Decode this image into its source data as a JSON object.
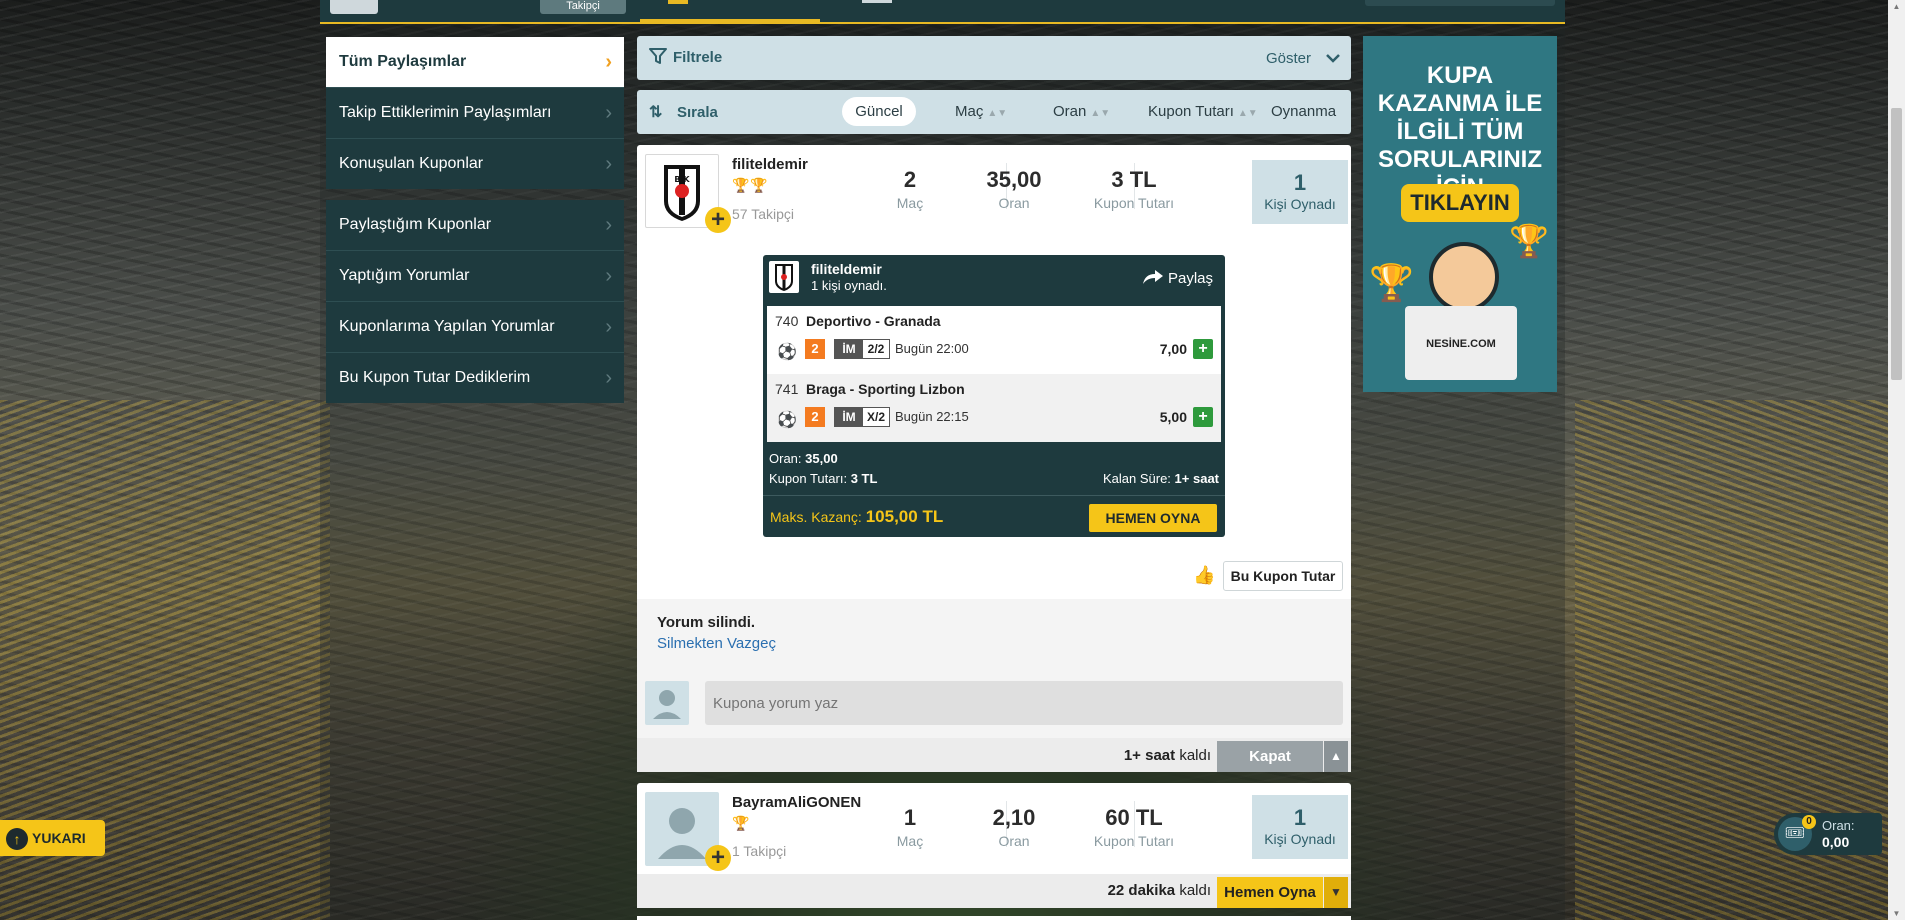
{
  "topbar": {
    "takipci_label": "Takipçi"
  },
  "left_menu": {
    "group1": [
      {
        "label": "Tüm Paylaşımlar",
        "active": true
      },
      {
        "label": "Takip Ettiklerimin Paylaşımları"
      },
      {
        "label": "Konuşulan Kuponlar"
      }
    ],
    "group2": [
      {
        "label": "Paylaştığım Kuponlar"
      },
      {
        "label": "Yaptığım Yorumlar"
      },
      {
        "label": "Kuponlarıma Yapılan Yorumlar"
      },
      {
        "label": "Bu Kupon Tutar Dediklerim"
      }
    ]
  },
  "filter": {
    "label": "Filtrele",
    "show_label": "Göster"
  },
  "sort": {
    "label": "Sırala",
    "options": [
      "Güncel",
      "Maç",
      "Oran",
      "Kupon Tutarı",
      "Oynanma"
    ]
  },
  "card1": {
    "username": "filiteldemir",
    "followers": "57 Takipçi",
    "stats": [
      {
        "value": "2",
        "label": "Maç"
      },
      {
        "value": "35,00",
        "label": "Oran"
      },
      {
        "value": "3 TL",
        "label": "Kupon Tutarı"
      }
    ],
    "played": {
      "value": "1",
      "label": "Kişi Oynadı"
    },
    "coupon": {
      "username": "filiteldemir",
      "played_text": "1 kişi oynadı.",
      "share_label": "Paylaş",
      "matches": [
        {
          "code": "740",
          "teams": "Deportivo - Granada",
          "num": "2",
          "bet_type": "İM",
          "pick": "2/2",
          "time": "Bugün 22:00",
          "odd": "7,00"
        },
        {
          "code": "741",
          "teams": "Braga - Sporting Lizbon",
          "num": "2",
          "bet_type": "İM",
          "pick": "X/2",
          "time": "Bugün 22:15",
          "odd": "5,00"
        }
      ],
      "oran_label": "Oran:",
      "oran_value": "35,00",
      "tutar_label": "Kupon Tutarı:",
      "tutar_value": "3 TL",
      "kalan_label": "Kalan Süre:",
      "kalan_value": "1+ saat",
      "maks_label": "Maks. Kazanç:",
      "maks_value": "105,00 TL",
      "play_button": "HEMEN OYNA"
    },
    "tutar_button": "Bu Kupon Tutar",
    "comment_deleted": "Yorum silindi.",
    "undo_link": "Silmekten Vazgeç",
    "comment_placeholder": "Kupona yorum yaz",
    "time_left_bold": "1+ saat",
    "time_left_suffix": "kaldı",
    "close_button": "Kapat"
  },
  "card2": {
    "username": "BayramAliGONEN",
    "followers": "1 Takipçi",
    "stats": [
      {
        "value": "1",
        "label": "Maç"
      },
      {
        "value": "2,10",
        "label": "Oran"
      },
      {
        "value": "60 TL",
        "label": "Kupon Tutarı"
      }
    ],
    "played": {
      "value": "1",
      "label": "Kişi Oynadı"
    },
    "time_left_bold": "22 dakika",
    "time_left_suffix": "kaldı",
    "play_button": "Hemen Oyna"
  },
  "ad": {
    "headline": "KUPA KAZANMA İLE İLGİLİ TÜM SORULARINIZ İÇİN",
    "cta": "TIKLAYIN",
    "brand": "NESİNE.COM"
  },
  "floating": {
    "up_label": "YUKARI",
    "cart_count": "0",
    "oran_label": "Oran:",
    "oran_value": "0,00"
  },
  "colors": {
    "dark_teal": "#1e3a3e",
    "accent_yellow": "#f5c518",
    "light_blue": "#cfe0e6"
  }
}
